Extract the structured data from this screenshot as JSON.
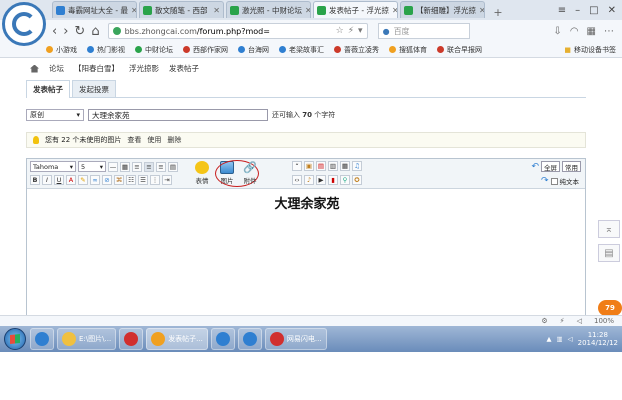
{
  "browser": {
    "tabs": [
      {
        "label": "毒霸网址大全 - 最",
        "color": "#2f7fd1"
      },
      {
        "label": "散文随笔 - 西部",
        "color": "#2aa34a"
      },
      {
        "label": "激光照 - 中财论坛",
        "color": "#2aa34a"
      },
      {
        "label": "发表帖子 - 浮光掠",
        "color": "#2aa34a",
        "active": true
      },
      {
        "label": "【新细雕】浮光掠",
        "color": "#2aa34a"
      }
    ],
    "address": {
      "host": "bbs.zhongcai.com",
      "path": "/forum.php?mod="
    },
    "search_placeholder": "百度",
    "bookmarks": [
      {
        "label": "小游戏",
        "color": "#f0a020"
      },
      {
        "label": "热门影视",
        "color": "#2f7fd1"
      },
      {
        "label": "中财论坛",
        "color": "#2aa34a"
      },
      {
        "label": "西部作家网",
        "color": "#cc3a2a"
      },
      {
        "label": "台海网",
        "color": "#2f7fd1"
      },
      {
        "label": "老梁故事汇",
        "color": "#2f7fd1"
      },
      {
        "label": "蔷薇立凌秀",
        "color": "#cc3a2a"
      },
      {
        "label": "搜狐体育",
        "color": "#f0a020"
      },
      {
        "label": "联合早报网",
        "color": "#cc3a2a"
      }
    ],
    "bookmark_right": "移动设备书签"
  },
  "page": {
    "crumbs": [
      "论坛",
      "【阳春白雪】",
      "浮光掠影",
      "发表帖子"
    ],
    "tabs": [
      "发表帖子",
      "发起投票"
    ],
    "category": "原创",
    "title_value": "大理余家苑",
    "remain_prefix": "还可输入",
    "remain_count": "70",
    "remain_suffix": "个字符",
    "attach": {
      "text_prefix": "您有",
      "count": "22",
      "text_suffix": "个未使用的图片",
      "view": "查看",
      "use": "使用",
      "delete": "删除"
    }
  },
  "editor": {
    "font": "Tahoma",
    "size": "5",
    "big_buttons": [
      "表情",
      "图片",
      "附件"
    ],
    "fullscreen": "全屏",
    "common": "常用",
    "plain_text": "纯文本",
    "content_title": "大理余家苑"
  },
  "float_badge": "79",
  "status": {
    "zoom": "100%"
  },
  "taskbar": {
    "tasks": [
      {
        "label": "",
        "color": "#2f7fd1"
      },
      {
        "label": "E:\\图片\\...",
        "color": "#f0c040"
      },
      {
        "label": "",
        "color": "#d12f2f"
      },
      {
        "label": "发表帖子...",
        "color": "#f0a020",
        "active": true
      },
      {
        "label": "",
        "color": "#2f7fd1"
      },
      {
        "label": "",
        "color": "#2f7fd1"
      },
      {
        "label": "网易闪电...",
        "color": "#d12f2f"
      }
    ],
    "time": "11:28",
    "date": "2014/12/12"
  }
}
